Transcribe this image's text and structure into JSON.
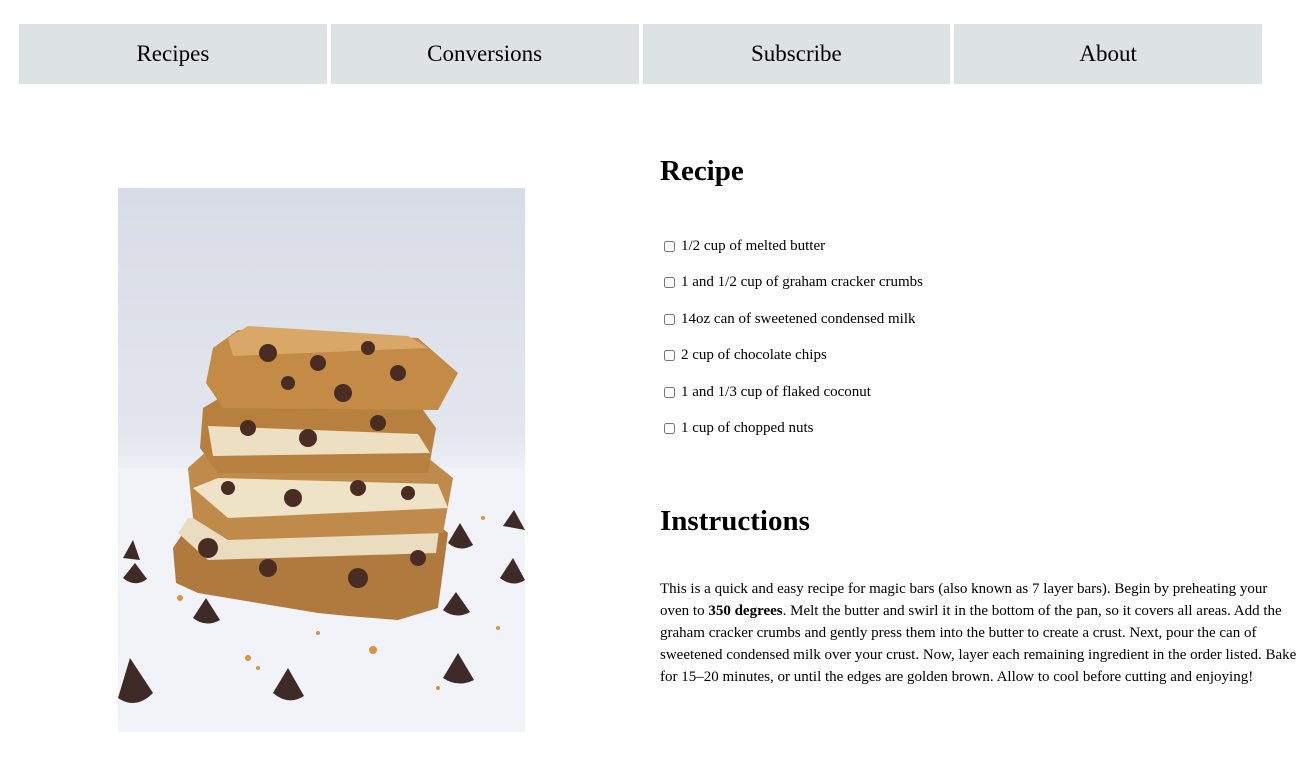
{
  "nav": {
    "items": [
      "Recipes",
      "Conversions",
      "Subscribe",
      "About"
    ]
  },
  "image": {
    "alt": "Stack of magic bars with chocolate chips"
  },
  "recipe": {
    "title": "Recipe",
    "ingredients": [
      "1/2 cup of melted butter",
      "1 and 1/2 cup of graham cracker crumbs",
      "14oz can of sweetened condensed milk",
      "2 cup of chocolate chips",
      "1 and 1/3 cup of flaked coconut",
      "1 cup of chopped nuts"
    ]
  },
  "instructions": {
    "title": "Instructions",
    "text_before": "This is a quick and easy recipe for magic bars (also known as 7 layer bars). Begin by preheating your oven to ",
    "bold": "350 degrees",
    "text_after": ". Melt the butter and swirl it in the bottom of the pan, so it covers all areas. Add the graham cracker crumbs and gently press them into the butter to create a crust. Next, pour the can of sweetened condensed milk over your crust. Now, layer each remaining ingredient in the order listed. Bake for 15–20 minutes, or until the edges are golden brown. Allow to cool before cutting and enjoying!"
  }
}
